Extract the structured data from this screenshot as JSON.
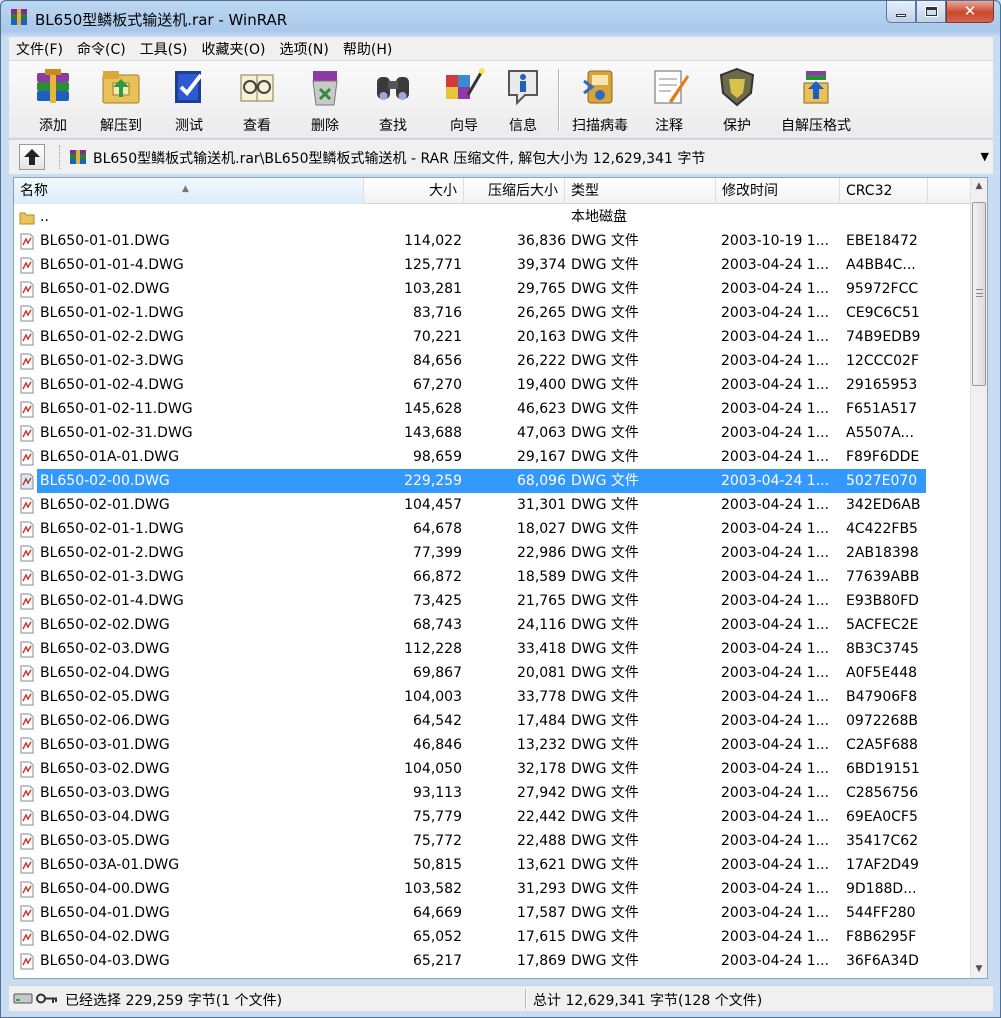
{
  "window": {
    "title": "BL650型鳞板式输送机.rar - WinRAR"
  },
  "menu": [
    "文件(F)",
    "命令(C)",
    "工具(S)",
    "收藏夹(O)",
    "选项(N)",
    "帮助(H)"
  ],
  "toolbar": [
    {
      "label": "添加",
      "icon": "add-archive-icon"
    },
    {
      "label": "解压到",
      "icon": "extract-to-icon"
    },
    {
      "label": "测试",
      "icon": "test-icon"
    },
    {
      "label": "查看",
      "icon": "view-icon"
    },
    {
      "label": "删除",
      "icon": "delete-icon"
    },
    {
      "label": "查找",
      "icon": "find-icon"
    },
    {
      "label": "向导",
      "icon": "wizard-icon"
    },
    {
      "label": "信息",
      "icon": "info-icon"
    },
    {
      "label": "扫描病毒",
      "icon": "virus-scan-icon"
    },
    {
      "label": "注释",
      "icon": "comment-icon"
    },
    {
      "label": "保护",
      "icon": "protect-icon"
    },
    {
      "label": "自解压格式",
      "icon": "sfx-icon"
    }
  ],
  "address": {
    "path": "BL650型鳞板式输送机.rar\\BL650型鳞板式输送机 - RAR 压缩文件, 解包大小为 12,629,341 字节"
  },
  "columns": {
    "name": "名称",
    "size": "大小",
    "packed": "压缩后大小",
    "type": "类型",
    "modified": "修改时间",
    "crc": "CRC32"
  },
  "parent_row": {
    "name": "..",
    "type": "本地磁盘"
  },
  "files": [
    {
      "name": "BL650-01-01.DWG",
      "size": "114,022",
      "packed": "36,836",
      "type": "DWG 文件",
      "modified": "2003-10-19 1...",
      "crc": "EBE18472"
    },
    {
      "name": "BL650-01-01-4.DWG",
      "size": "125,771",
      "packed": "39,374",
      "type": "DWG 文件",
      "modified": "2003-04-24 1...",
      "crc": "A4BB4C..."
    },
    {
      "name": "BL650-01-02.DWG",
      "size": "103,281",
      "packed": "29,765",
      "type": "DWG 文件",
      "modified": "2003-04-24 1...",
      "crc": "95972FCC"
    },
    {
      "name": "BL650-01-02-1.DWG",
      "size": "83,716",
      "packed": "26,265",
      "type": "DWG 文件",
      "modified": "2003-04-24 1...",
      "crc": "CE9C6C51"
    },
    {
      "name": "BL650-01-02-2.DWG",
      "size": "70,221",
      "packed": "20,163",
      "type": "DWG 文件",
      "modified": "2003-04-24 1...",
      "crc": "74B9EDB9"
    },
    {
      "name": "BL650-01-02-3.DWG",
      "size": "84,656",
      "packed": "26,222",
      "type": "DWG 文件",
      "modified": "2003-04-24 1...",
      "crc": "12CCC02F"
    },
    {
      "name": "BL650-01-02-4.DWG",
      "size": "67,270",
      "packed": "19,400",
      "type": "DWG 文件",
      "modified": "2003-04-24 1...",
      "crc": "29165953"
    },
    {
      "name": "BL650-01-02-11.DWG",
      "size": "145,628",
      "packed": "46,623",
      "type": "DWG 文件",
      "modified": "2003-04-24 1...",
      "crc": "F651A517"
    },
    {
      "name": "BL650-01-02-31.DWG",
      "size": "143,688",
      "packed": "47,063",
      "type": "DWG 文件",
      "modified": "2003-04-24 1...",
      "crc": "A5507A..."
    },
    {
      "name": "BL650-01A-01.DWG",
      "size": "98,659",
      "packed": "29,167",
      "type": "DWG 文件",
      "modified": "2003-04-24 1...",
      "crc": "F89F6DDE"
    },
    {
      "name": "BL650-02-00.DWG",
      "size": "229,259",
      "packed": "68,096",
      "type": "DWG 文件",
      "modified": "2003-04-24 1...",
      "crc": "5027E070",
      "selected": true
    },
    {
      "name": "BL650-02-01.DWG",
      "size": "104,457",
      "packed": "31,301",
      "type": "DWG 文件",
      "modified": "2003-04-24 1...",
      "crc": "342ED6AB"
    },
    {
      "name": "BL650-02-01-1.DWG",
      "size": "64,678",
      "packed": "18,027",
      "type": "DWG 文件",
      "modified": "2003-04-24 1...",
      "crc": "4C422FB5"
    },
    {
      "name": "BL650-02-01-2.DWG",
      "size": "77,399",
      "packed": "22,986",
      "type": "DWG 文件",
      "modified": "2003-04-24 1...",
      "crc": "2AB18398"
    },
    {
      "name": "BL650-02-01-3.DWG",
      "size": "66,872",
      "packed": "18,589",
      "type": "DWG 文件",
      "modified": "2003-04-24 1...",
      "crc": "77639ABB"
    },
    {
      "name": "BL650-02-01-4.DWG",
      "size": "73,425",
      "packed": "21,765",
      "type": "DWG 文件",
      "modified": "2003-04-24 1...",
      "crc": "E93B80FD"
    },
    {
      "name": "BL650-02-02.DWG",
      "size": "68,743",
      "packed": "24,116",
      "type": "DWG 文件",
      "modified": "2003-04-24 1...",
      "crc": "5ACFEC2E"
    },
    {
      "name": "BL650-02-03.DWG",
      "size": "112,228",
      "packed": "33,418",
      "type": "DWG 文件",
      "modified": "2003-04-24 1...",
      "crc": "8B3C3745"
    },
    {
      "name": "BL650-02-04.DWG",
      "size": "69,867",
      "packed": "20,081",
      "type": "DWG 文件",
      "modified": "2003-04-24 1...",
      "crc": "A0F5E448"
    },
    {
      "name": "BL650-02-05.DWG",
      "size": "104,003",
      "packed": "33,778",
      "type": "DWG 文件",
      "modified": "2003-04-24 1...",
      "crc": "B47906F8"
    },
    {
      "name": "BL650-02-06.DWG",
      "size": "64,542",
      "packed": "17,484",
      "type": "DWG 文件",
      "modified": "2003-04-24 1...",
      "crc": "0972268B"
    },
    {
      "name": "BL650-03-01.DWG",
      "size": "46,846",
      "packed": "13,232",
      "type": "DWG 文件",
      "modified": "2003-04-24 1...",
      "crc": "C2A5F688"
    },
    {
      "name": "BL650-03-02.DWG",
      "size": "104,050",
      "packed": "32,178",
      "type": "DWG 文件",
      "modified": "2003-04-24 1...",
      "crc": "6BD19151"
    },
    {
      "name": "BL650-03-03.DWG",
      "size": "93,113",
      "packed": "27,942",
      "type": "DWG 文件",
      "modified": "2003-04-24 1...",
      "crc": "C2856756"
    },
    {
      "name": "BL650-03-04.DWG",
      "size": "75,779",
      "packed": "22,442",
      "type": "DWG 文件",
      "modified": "2003-04-24 1...",
      "crc": "69EA0CF5"
    },
    {
      "name": "BL650-03-05.DWG",
      "size": "75,772",
      "packed": "22,488",
      "type": "DWG 文件",
      "modified": "2003-04-24 1...",
      "crc": "35417C62"
    },
    {
      "name": "BL650-03A-01.DWG",
      "size": "50,815",
      "packed": "13,621",
      "type": "DWG 文件",
      "modified": "2003-04-24 1...",
      "crc": "17AF2D49"
    },
    {
      "name": "BL650-04-00.DWG",
      "size": "103,582",
      "packed": "31,293",
      "type": "DWG 文件",
      "modified": "2003-04-24 1...",
      "crc": "9D188D..."
    },
    {
      "name": "BL650-04-01.DWG",
      "size": "64,669",
      "packed": "17,587",
      "type": "DWG 文件",
      "modified": "2003-04-24 1...",
      "crc": "544FF280"
    },
    {
      "name": "BL650-04-02.DWG",
      "size": "65,052",
      "packed": "17,615",
      "type": "DWG 文件",
      "modified": "2003-04-24 1...",
      "crc": "F8B6295F"
    },
    {
      "name": "BL650-04-03.DWG",
      "size": "65,217",
      "packed": "17,869",
      "type": "DWG 文件",
      "modified": "2003-04-24 1...",
      "crc": "36F6A34D"
    }
  ],
  "status": {
    "selected": "已经选择 229,259 字节(1 个文件)",
    "total": "总计 12,629,341 字节(128 个文件)"
  },
  "colors": {
    "selection": "#3399ff",
    "titlebar": "#bcd7f1",
    "close": "#c9472e"
  }
}
